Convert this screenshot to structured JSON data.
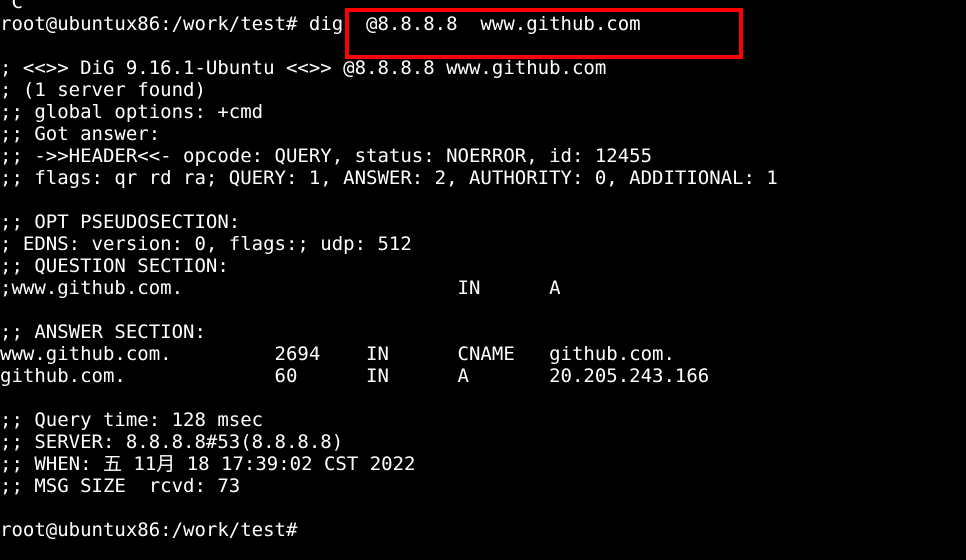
{
  "terminal": {
    "lines": [
      "^C",
      "root@ubuntux86:/work/test# dig  @8.8.8.8  www.github.com",
      "",
      "; <<>> DiG 9.16.1-Ubuntu <<>> @8.8.8.8 www.github.com",
      "; (1 server found)",
      ";; global options: +cmd",
      ";; Got answer:",
      ";; ->>HEADER<<- opcode: QUERY, status: NOERROR, id: 12455",
      ";; flags: qr rd ra; QUERY: 1, ANSWER: 2, AUTHORITY: 0, ADDITIONAL: 1",
      "",
      ";; OPT PSEUDOSECTION:",
      "; EDNS: version: 0, flags:; udp: 512",
      ";; QUESTION SECTION:",
      ";www.github.com.                        IN      A",
      "",
      ";; ANSWER SECTION:",
      "www.github.com.         2694    IN      CNAME   github.com.",
      "github.com.             60      IN      A       20.205.243.166",
      "",
      ";; Query time: 128 msec",
      ";; SERVER: 8.8.8.8#53(8.8.8.8)",
      ";; WHEN: 五 11月 18 17:39:02 CST 2022",
      ";; MSG SIZE  rcvd: 73",
      "",
      "root@ubuntux86:/work/test#"
    ]
  },
  "colors": {
    "background": "#000000",
    "text": "#ffffff",
    "highlight": "#ff0000"
  }
}
